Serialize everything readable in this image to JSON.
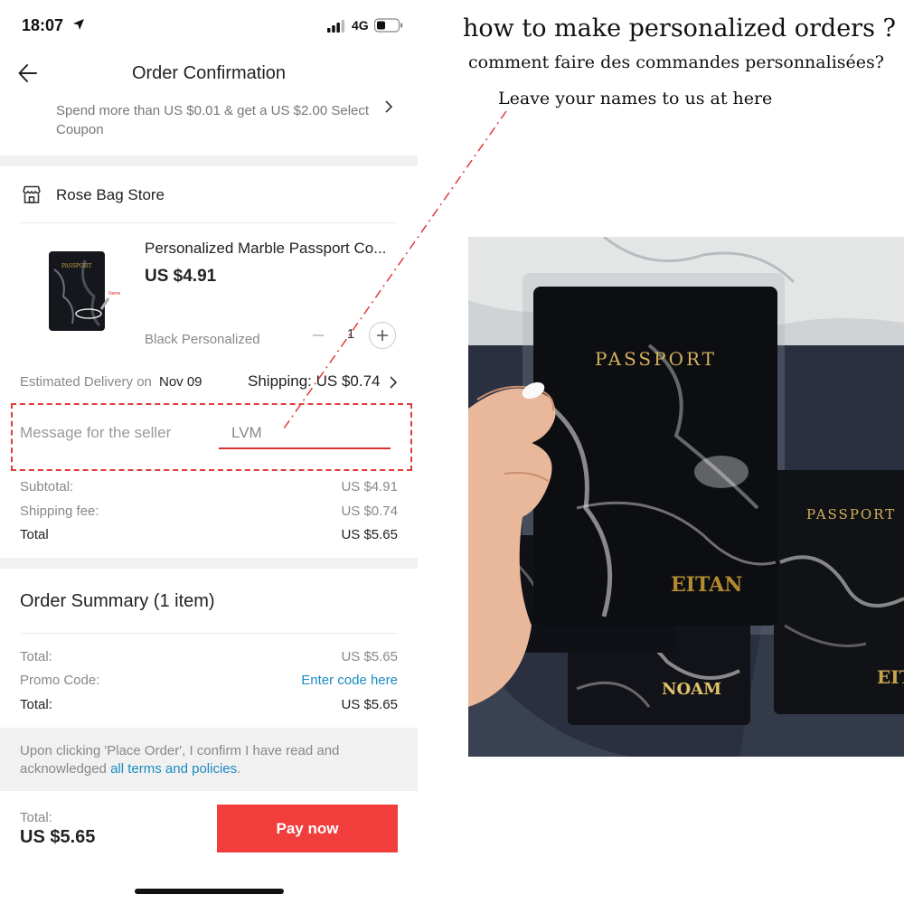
{
  "status_bar": {
    "time": "18:07",
    "network": "4G",
    "icons": [
      "location-arrow-icon",
      "signal-bars-icon",
      "battery-icon"
    ]
  },
  "nav": {
    "title": "Order Confirmation",
    "back_icon": "back-arrow-icon"
  },
  "coupon": {
    "text": "Spend more than US $0.01 & get a US $2.00 Select Coupon"
  },
  "store": {
    "name": "Rose Bag Store",
    "icon": "store-icon"
  },
  "product": {
    "title": "Personalized Marble Passport Co...",
    "price": "US $4.91",
    "variant": "Black Personalized",
    "quantity": "1",
    "thumb_cover_text": "PASSPORT",
    "thumb_tag_text": "Name"
  },
  "delivery": {
    "label": "Estimated Delivery on",
    "date": "Nov  09",
    "shipping": "Shipping: US $0.74"
  },
  "message": {
    "label": "Message for the seller",
    "value": "LVM"
  },
  "costs": {
    "subtotal_label": "Subtotal:",
    "subtotal_value": "US $4.91",
    "shipping_fee_label": "Shipping fee:",
    "shipping_fee_value": "US $0.74",
    "total_label": "Total",
    "total_value": "US $5.65"
  },
  "order_summary": {
    "title": "Order Summary (1 item)",
    "total1_label": "Total:",
    "total1_value": "US $5.65",
    "promo_label": "Promo Code:",
    "promo_link": "Enter code here",
    "total2_label": "Total:",
    "total2_value": "US $5.65"
  },
  "terms": {
    "text": "Upon clicking 'Place Order', I confirm I have read and acknowledged ",
    "link": "all terms and policies",
    "end": "."
  },
  "footer": {
    "total_label": "Total:",
    "total_amount": "US $5.65",
    "pay_label": "Pay now"
  },
  "instructions": {
    "heading_en": "how to make personalized orders ?",
    "heading_fr": "comment faire des commandes personnalisées?",
    "note": "Leave your names to us at here"
  },
  "photo": {
    "cover_title": "PASSPORT",
    "names": [
      "EITAN",
      "NOAM",
      "EITA"
    ]
  },
  "colors": {
    "accent_red": "#f23d3d",
    "link_blue": "#1a8cc1",
    "annotation_red": "#e03a3a",
    "foil_gold": "#d4b25a"
  }
}
